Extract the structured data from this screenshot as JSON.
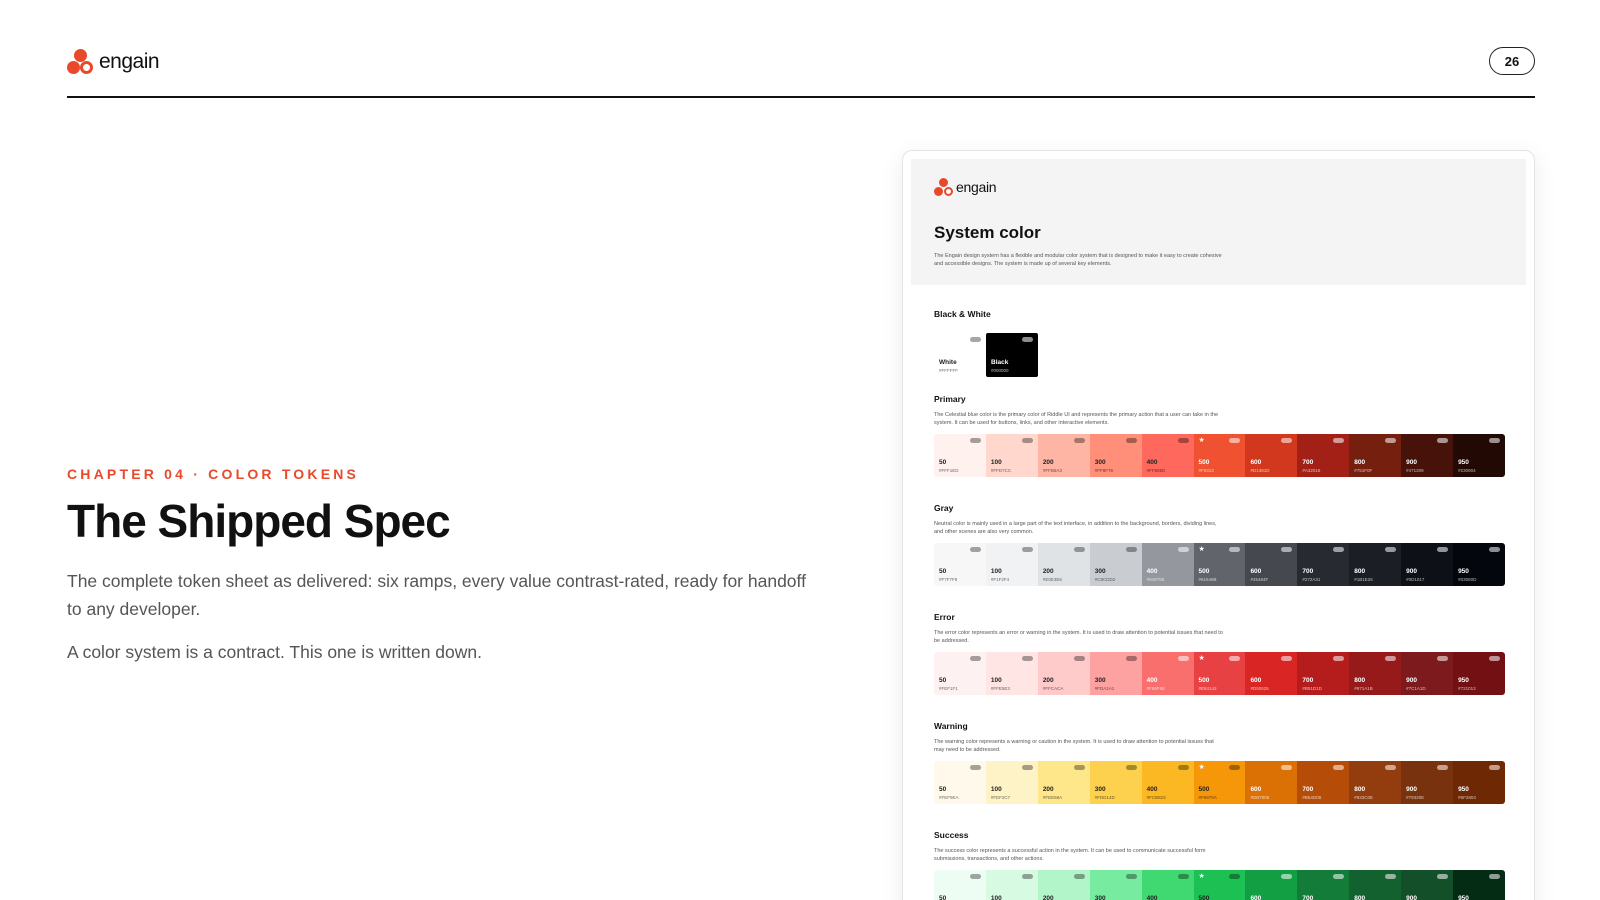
{
  "header": {
    "brand_name": "engain",
    "page_number": "26"
  },
  "intro": {
    "eyebrow": "CHAPTER 04 · COLOR TOKENS",
    "title": "The Shipped Spec",
    "lead": "The complete token sheet as delivered: six ramps, every value contrast-rated, ready for handoff to any developer.",
    "tagline": "A color system is a contract. This one is written down."
  },
  "card": {
    "brand_name": "engain",
    "title": "System color",
    "description": "The Engain design system has a flexible and modular color system that is designed to make it easy to create cohesive and accessible designs. The system is made up of several key elements.",
    "black_white": {
      "label": "Black & White",
      "swatches": [
        {
          "name": "White",
          "hex": "#FFFFFF",
          "color": "#FFFFFF"
        },
        {
          "name": "Black",
          "hex": "#000000",
          "color": "#000000"
        }
      ]
    },
    "ramps": [
      {
        "name": "Primary",
        "description": "The Celestial blue color is the primary color of Riddle UI and represents the primary action that a user can take in the system. It can be used for buttons, links, and other interactive elements.",
        "swatches": [
          {
            "step": "50",
            "hex": "#FFF1ED",
            "color": "#FFF1ED"
          },
          {
            "step": "100",
            "hex": "#FFD7CC",
            "color": "#FFD7CC"
          },
          {
            "step": "200",
            "hex": "#FFB5A3",
            "color": "#FFB5A3"
          },
          {
            "step": "300",
            "hex": "#FF8F78",
            "color": "#FF8F78"
          },
          {
            "step": "400",
            "hex": "#FF685D",
            "color": "#FF685D"
          },
          {
            "step": "500",
            "hex": "#F9313",
            "color": "#F05131"
          },
          {
            "step": "600",
            "hex": "#D1381D",
            "color": "#D1381D"
          },
          {
            "step": "700",
            "hex": "#A32016",
            "color": "#A32016"
          },
          {
            "step": "800",
            "hex": "#751F0F",
            "color": "#751F0F"
          },
          {
            "step": "900",
            "hex": "#471209",
            "color": "#471209"
          },
          {
            "step": "950",
            "hex": "#230904",
            "color": "#230904"
          }
        ]
      },
      {
        "name": "Gray",
        "description": "Neutral color is mainly used in a large part of the text interface, in addition to the background, borders, dividing lines, and other scenes are also very common.",
        "swatches": [
          {
            "step": "50",
            "hex": "#F7F7F8",
            "color": "#F7F7F8"
          },
          {
            "step": "100",
            "hex": "#F1F2F4",
            "color": "#F1F2F4"
          },
          {
            "step": "200",
            "hex": "#E0E3E6",
            "color": "#E0E3E6"
          },
          {
            "step": "300",
            "hex": "#C9CDD2",
            "color": "#C9CDD2"
          },
          {
            "step": "400",
            "hex": "#94979E",
            "color": "#94979E"
          },
          {
            "step": "500",
            "hex": "#61646B",
            "color": "#61646B"
          },
          {
            "step": "600",
            "hex": "#45484F",
            "color": "#45484F"
          },
          {
            "step": "700",
            "hex": "#272A31",
            "color": "#272A31"
          },
          {
            "step": "800",
            "hex": "#1B1E25",
            "color": "#1B1E25"
          },
          {
            "step": "900",
            "hex": "#0D1017",
            "color": "#0D1017"
          },
          {
            "step": "950",
            "hex": "#03060D",
            "color": "#03060D"
          }
        ]
      },
      {
        "name": "Error",
        "description": "The error color represents an error or warning in the system. It is used to draw attention to potential issues that need to be addressed.",
        "swatches": [
          {
            "step": "50",
            "hex": "#FEF1F1",
            "color": "#FEF1F1"
          },
          {
            "step": "100",
            "hex": "#FFE5E3",
            "color": "#FFE5E3"
          },
          {
            "step": "200",
            "hex": "#FFCACA",
            "color": "#FFCACA"
          },
          {
            "step": "300",
            "hex": "#FDA1A1",
            "color": "#FDA1A1"
          },
          {
            "step": "400",
            "hex": "#F86F6E",
            "color": "#F86F6E"
          },
          {
            "step": "500",
            "hex": "#E84143",
            "color": "#E84143"
          },
          {
            "step": "600",
            "hex": "#D92625",
            "color": "#D92625"
          },
          {
            "step": "700",
            "hex": "#B51D1D",
            "color": "#B51D1D"
          },
          {
            "step": "800",
            "hex": "#971A1B",
            "color": "#971A1B"
          },
          {
            "step": "900",
            "hex": "#7C1A1D",
            "color": "#7C1A1D"
          },
          {
            "step": "950",
            "hex": "#721013",
            "color": "#721013"
          }
        ]
      },
      {
        "name": "Warning",
        "description": "The warning color represents a warning or caution in the system. It is used to draw attention to potential issues that may need to be addressed.",
        "swatches": [
          {
            "step": "50",
            "hex": "#FEF9EA",
            "color": "#FEF9EA"
          },
          {
            "step": "100",
            "hex": "#FEF2C7",
            "color": "#FEF2C7"
          },
          {
            "step": "200",
            "hex": "#FEE68A",
            "color": "#FEE68A"
          },
          {
            "step": "300",
            "hex": "#FDD14D",
            "color": "#FDD14D"
          },
          {
            "step": "400",
            "hex": "#FCB823",
            "color": "#FCB823"
          },
          {
            "step": "500",
            "hex": "#F6970A",
            "color": "#F6970A"
          },
          {
            "step": "600",
            "hex": "#DB7005",
            "color": "#DB7005"
          },
          {
            "step": "700",
            "hex": "#B54D08",
            "color": "#B54D08"
          },
          {
            "step": "800",
            "hex": "#933C0E",
            "color": "#933C0E"
          },
          {
            "step": "900",
            "hex": "#79320E",
            "color": "#79320E"
          },
          {
            "step": "950",
            "hex": "#6F2804",
            "color": "#6F2804"
          }
        ]
      },
      {
        "name": "Success",
        "description": "The success color represents a successful action in the system. It can be used to communicate successful form submissions, transactions, and other actions.",
        "swatches": [
          {
            "step": "50",
            "hex": "",
            "color": "#EEFDF3"
          },
          {
            "step": "100",
            "hex": "",
            "color": "#D7FBE2"
          },
          {
            "step": "200",
            "hex": "",
            "color": "#B2F5C8"
          },
          {
            "step": "300",
            "hex": "",
            "color": "#77EBA0"
          },
          {
            "step": "400",
            "hex": "",
            "color": "#3FD871"
          },
          {
            "step": "500",
            "hex": "",
            "color": "#1CC053"
          },
          {
            "step": "600",
            "hex": "",
            "color": "#129F43"
          },
          {
            "step": "700",
            "hex": "",
            "color": "#127C38"
          },
          {
            "step": "800",
            "hex": "",
            "color": "#146130"
          },
          {
            "step": "900",
            "hex": "",
            "color": "#13502A"
          },
          {
            "step": "950",
            "hex": "",
            "color": "#042C14"
          }
        ]
      }
    ]
  }
}
